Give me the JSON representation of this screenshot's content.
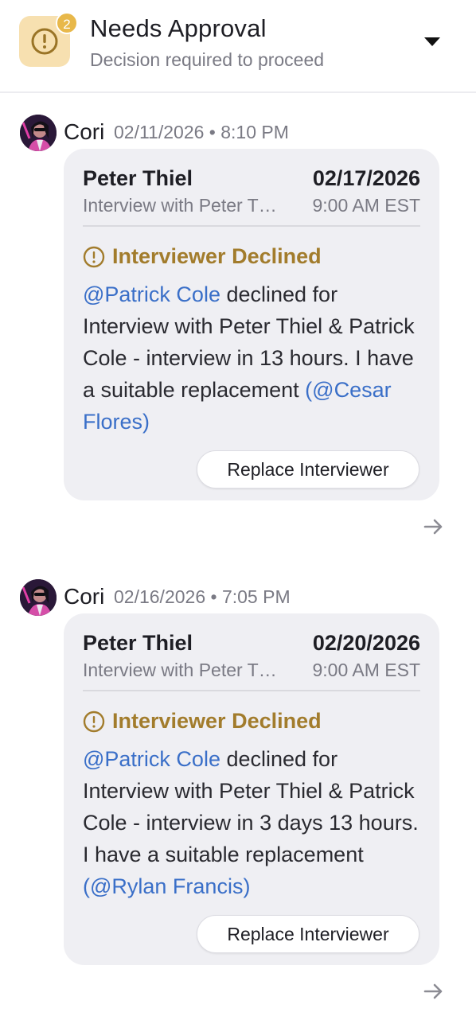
{
  "header": {
    "title": "Needs Approval",
    "subtitle": "Decision required to proceed",
    "badge_count": "2",
    "icon": "alert-circle-icon",
    "toggle_icon": "caret-down-icon"
  },
  "colors": {
    "accent_warning": "#a27c2c",
    "icon_box_bg": "#f7e0b0",
    "badge_bg": "#e8b84a",
    "mention": "#3a6fc8",
    "card_bg": "#efeff3"
  },
  "messages": [
    {
      "author": "Cori",
      "timestamp": "02/11/2026 • 8:10 PM",
      "card": {
        "candidate": "Peter Thiel",
        "date": "02/17/2026",
        "event": "Interview with Peter Thiel & Patrick Cole",
        "time": "9:00 AM EST",
        "status": "Interviewer Declined",
        "mention": "@Patrick Cole",
        "body": " declined for Interview with Peter Thiel & Patrick Cole - interview in 13 hours. I have a suitable replacement ",
        "replacement": "(@Cesar Flores)",
        "action_label": "Replace Interviewer"
      }
    },
    {
      "author": "Cori",
      "timestamp": "02/16/2026 • 7:05 PM",
      "card": {
        "candidate": "Peter Thiel",
        "date": "02/20/2026",
        "event": "Interview with Peter Thiel & Patrick Cole",
        "time": "9:00 AM EST",
        "status": "Interviewer Declined",
        "mention": "@Patrick Cole",
        "body": " declined for Interview with Peter Thiel & Patrick Cole - interview in 3 days 13 hours. I have a suitable replacement ",
        "replacement": "(@Rylan Francis)",
        "action_label": "Replace Interviewer"
      }
    }
  ]
}
